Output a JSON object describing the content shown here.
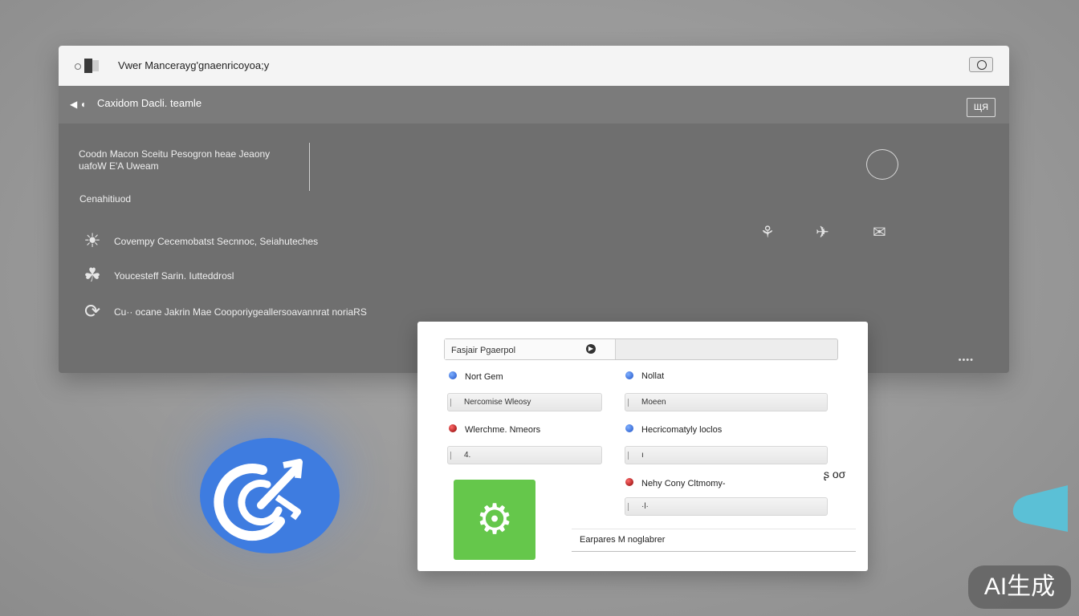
{
  "window": {
    "title": "Vwer Mancerayg'gnaenricoyoa;y",
    "subbar_back": "◀ ◖",
    "subbar_title": "Caxidom Dacli. teamle",
    "subbar_button": "ЩЯ",
    "description": "Coodn Macon  Sceitu  Pesogron heae Jeaony uafoW E'A Uweam",
    "section_label": "Cenahitiuod",
    "items": [
      {
        "label": "Covempy Cecemobatst Secnnoc, Seiahuteches",
        "icon": "☀"
      },
      {
        "label": "Youcesteff Sarin. Iutteddrosl",
        "icon": "☘"
      },
      {
        "label": "Cu·· ocane Jakrin Mae Cooporiygeallersoavannrat noriaRS",
        "icon": "⟳"
      }
    ],
    "right_icons": [
      "⚘",
      "✈",
      "✉"
    ],
    "corner_dots": "••••"
  },
  "dialog": {
    "search_value": "Fasjair Pgaerpol",
    "left_col": [
      {
        "radio_color": "blue",
        "radio_label": "Nort Gem",
        "field": "Nercomise Wleosy"
      },
      {
        "radio_color": "red",
        "radio_label": "Wlerchme. Nmeors",
        "field": "4."
      }
    ],
    "right_col": [
      {
        "radio_color": "blue",
        "radio_label": "Nollat",
        "field": "Moeen"
      },
      {
        "radio_color": "blue",
        "radio_label": "Hecricomatyly loclos",
        "field": "ı"
      },
      {
        "radio_color": "red",
        "radio_label": "Nehy Cony Cltmomy-",
        "field": "·l·"
      }
    ],
    "loop_label": "ʂ οσ",
    "extras_label": "Earpares M noglabrer",
    "settings_icon": "⚙"
  },
  "watermark": "AI生成",
  "colors": {
    "accent_blue": "#3e7ce0",
    "settings_green": "#65c74b",
    "cyan_shape": "#5bc0d6"
  }
}
